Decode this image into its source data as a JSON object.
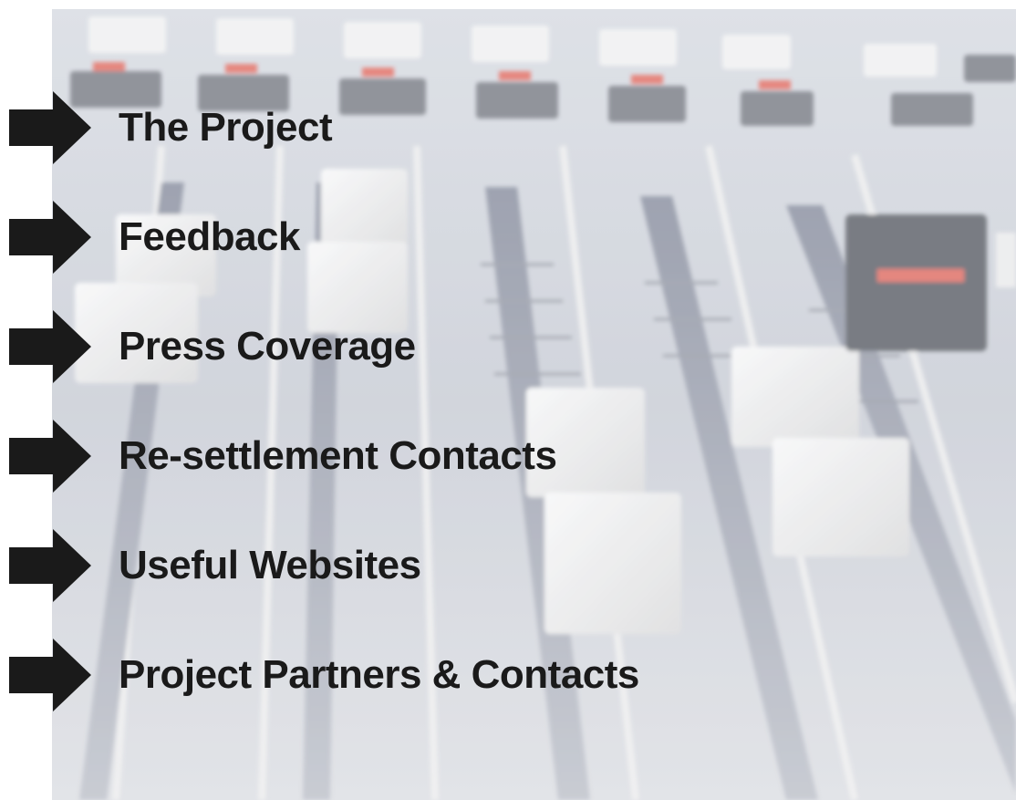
{
  "menu": {
    "items": [
      {
        "label": "The Project",
        "icon": "right-arrow-icon"
      },
      {
        "label": "Feedback",
        "icon": "right-arrow-icon"
      },
      {
        "label": "Press Coverage",
        "icon": "right-arrow-icon"
      },
      {
        "label": "Re-settlement Contacts",
        "icon": "right-arrow-icon"
      },
      {
        "label": "Useful Websites",
        "icon": "right-arrow-icon"
      },
      {
        "label": "Project Partners & Contacts",
        "icon": "right-arrow-icon"
      }
    ]
  },
  "colors": {
    "text": "#1a1a1a",
    "arrow": "#1a1a1a",
    "background": "#ffffff",
    "console_base": "#c9ced8",
    "fader_cap": "#f2f2f2",
    "button_red": "#e35b4f"
  }
}
